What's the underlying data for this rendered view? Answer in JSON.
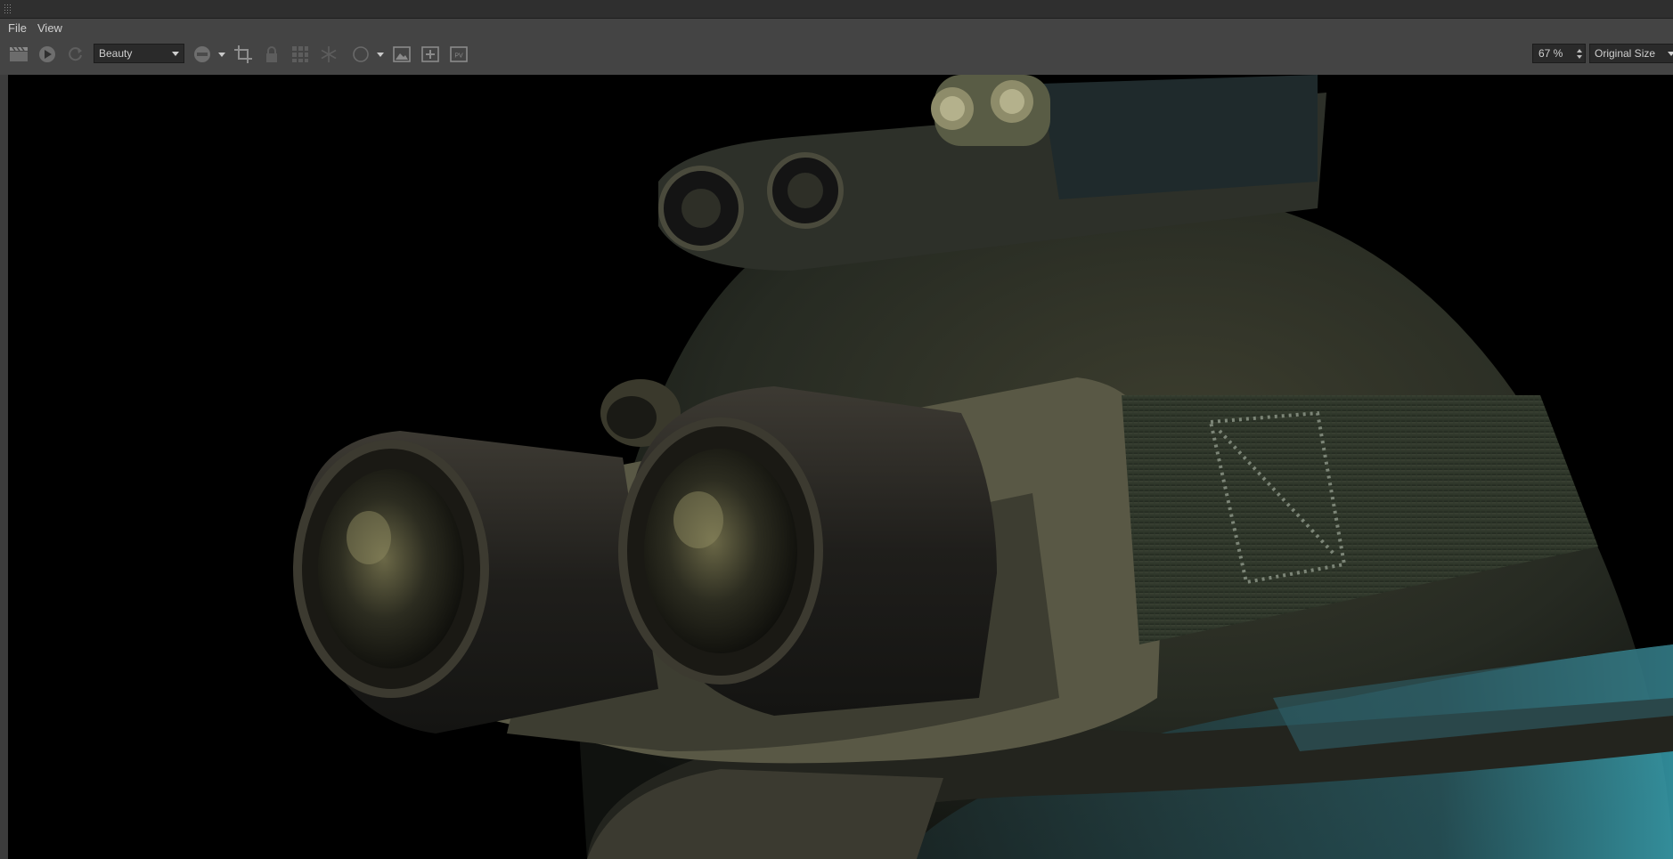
{
  "menu": {
    "file": "File",
    "view": "View"
  },
  "toolbar": {
    "pass_select": "Beauty",
    "zoom": "67 %",
    "size_select": "Original Size",
    "icons": [
      "clapperboard-icon",
      "play-icon",
      "refresh-icon",
      "rgb-channel-icon",
      "crop-icon",
      "lock-icon",
      "grid-icon",
      "snowflake-icon",
      "circle-icon",
      "image-icon",
      "add-image-icon",
      "pv-icon"
    ]
  },
  "render": {
    "description_colors": {
      "background": "#000000",
      "metal": "#3a3d2c",
      "strap": "#2b3228",
      "highlight": "#c8c08a",
      "cyan_rim": "#3fb6c8"
    }
  }
}
